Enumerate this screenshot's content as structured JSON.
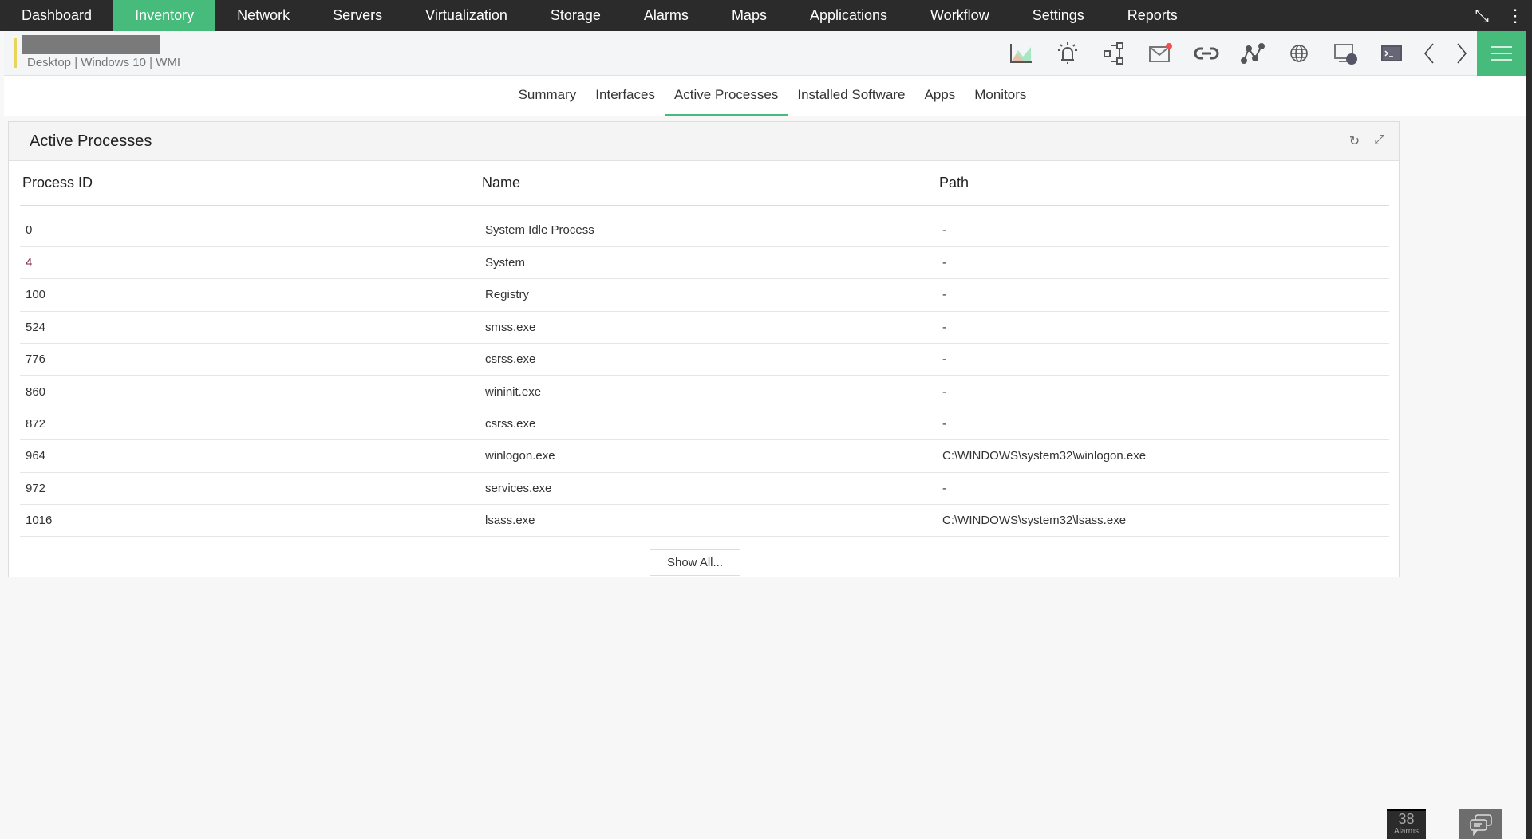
{
  "topnav": {
    "items": [
      "Dashboard",
      "Inventory",
      "Network",
      "Servers",
      "Virtualization",
      "Storage",
      "Alarms",
      "Maps",
      "Applications",
      "Workflow",
      "Settings",
      "Reports"
    ],
    "active": "Inventory"
  },
  "device": {
    "meta": "Desktop | Windows 10  | WMI"
  },
  "tabs": {
    "items": [
      "Summary",
      "Interfaces",
      "Active Processes",
      "Installed Software",
      "Apps",
      "Monitors"
    ],
    "active": "Active Processes"
  },
  "panel": {
    "title": "Active Processes",
    "columns": [
      "Process ID",
      "Name",
      "Path"
    ],
    "rows": [
      [
        "0",
        "System Idle Process",
        "-"
      ],
      [
        "4",
        "System",
        "-"
      ],
      [
        "100",
        "Registry",
        "-"
      ],
      [
        "524",
        "smss.exe",
        "-"
      ],
      [
        "776",
        "csrss.exe",
        "-"
      ],
      [
        "860",
        "wininit.exe",
        "-"
      ],
      [
        "872",
        "csrss.exe",
        "-"
      ],
      [
        "964",
        "winlogon.exe",
        "C:\\WINDOWS\\system32\\winlogon.exe"
      ],
      [
        "972",
        "services.exe",
        "-"
      ],
      [
        "1016",
        "lsass.exe",
        "C:\\WINDOWS\\system32\\lsass.exe"
      ]
    ],
    "show_all": "Show All..."
  },
  "footer": {
    "alarm_count": "38",
    "alarm_label": "Alarms"
  },
  "colors": {
    "accent": "#46bb7b",
    "nav_bg": "#2b2b2b"
  }
}
